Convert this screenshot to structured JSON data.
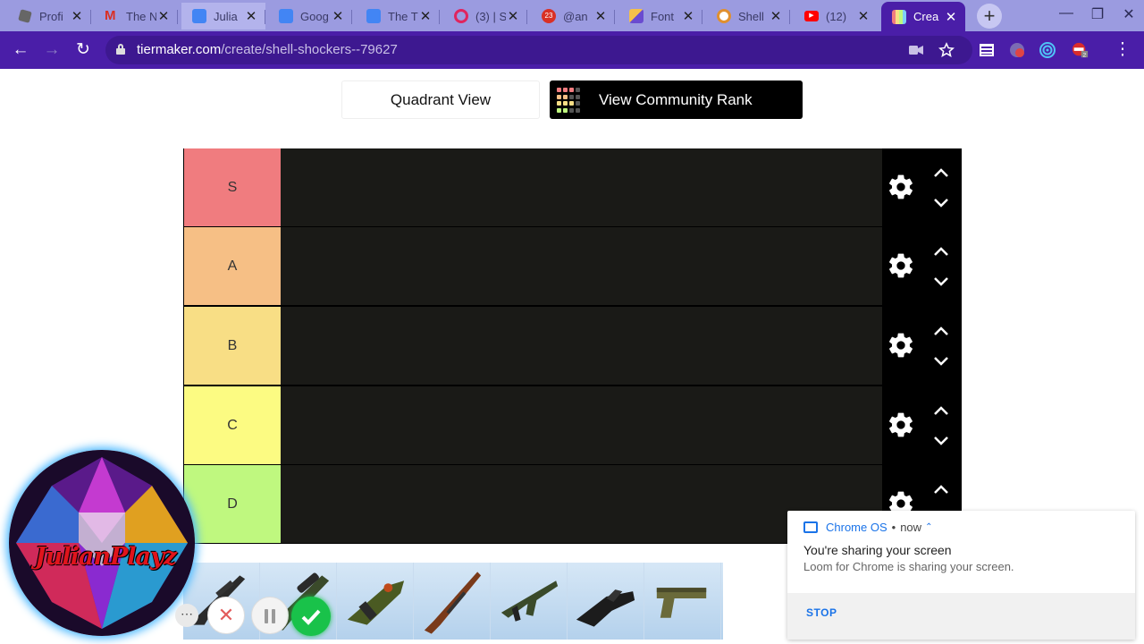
{
  "browser": {
    "tabs": [
      {
        "title": "Profi",
        "icon": "roblox-icon",
        "color": "#555555"
      },
      {
        "title": "The N",
        "icon": "gmail-icon",
        "color": "#d93025"
      },
      {
        "title": "Julia",
        "icon": "docs-icon",
        "color": "#4285f4"
      },
      {
        "title": "Goog",
        "icon": "docs-icon",
        "color": "#4285f4"
      },
      {
        "title": "The T",
        "icon": "docs-icon",
        "color": "#4285f4"
      },
      {
        "title": "(3) | S",
        "icon": "spiral-icon",
        "color": "#e0245e"
      },
      {
        "title": "@an",
        "icon": "calendar-icon",
        "color": "#d93025"
      },
      {
        "title": "Font",
        "icon": "brush-icon",
        "color": "#6a4bd0"
      },
      {
        "title": "Shell",
        "icon": "egg-icon",
        "color": "#e09030"
      },
      {
        "title": "(12)",
        "icon": "youtube-icon",
        "color": "#ff0000"
      },
      {
        "title": "Crea",
        "icon": "tiermaker-icon",
        "color": "#222222",
        "active": true
      }
    ],
    "url_host": "tiermaker.com",
    "url_path": "/create/shell-shockers--79627",
    "extension_badge": "2"
  },
  "page": {
    "quadrant_view": "Quadrant View",
    "community_rank": "View Community Rank",
    "tiers": [
      {
        "label": "S",
        "color": "#f07c7f"
      },
      {
        "label": "A",
        "color": "#f6bf85"
      },
      {
        "label": "B",
        "color": "#f8de85"
      },
      {
        "label": "C",
        "color": "#fcfb82"
      },
      {
        "label": "D",
        "color": "#bff87f"
      }
    ],
    "weapons": [
      "sniper-rifle",
      "scoped-rifle",
      "launcher",
      "shotgun",
      "assault-rifle",
      "smg",
      "pistol"
    ]
  },
  "loom": {
    "avatar_name": "JulianPlayz",
    "more": "⋯"
  },
  "notification": {
    "app": "Chrome OS",
    "time": "now",
    "title": "You're sharing your screen",
    "message": "Loom for Chrome is sharing your screen.",
    "stop": "STOP"
  }
}
